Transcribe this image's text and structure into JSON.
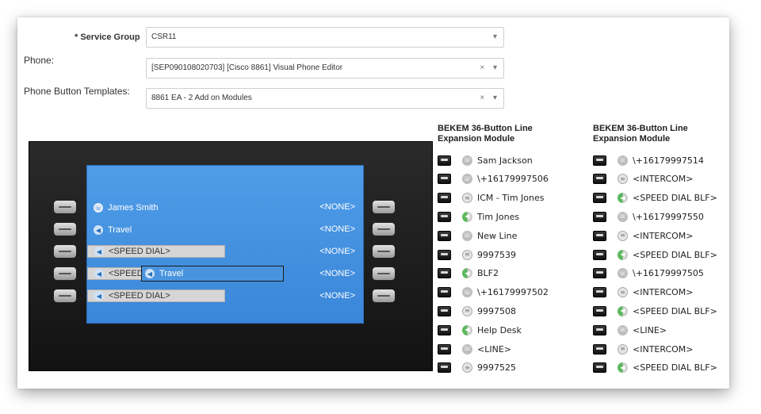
{
  "form": {
    "service_group": {
      "label": "* Service Group",
      "value": "CSR11"
    },
    "phone": {
      "label": "Phone:",
      "value": "[SEP090108020703] [Cisco 8861] Visual Phone Editor"
    },
    "template": {
      "label": "Phone Button Templates:",
      "value": "8861 EA - 2 Add on Modules"
    },
    "clear_glyph": "×",
    "caret_glyph": "▾"
  },
  "phone_screen": {
    "lines": [
      {
        "label": "James Smith",
        "type": "line"
      },
      {
        "label": "Travel",
        "type": "speed"
      },
      {
        "label": "<SPEED DIAL>",
        "type": "speed-bar"
      },
      {
        "label": "<SPEED",
        "type": "speed-bar"
      },
      {
        "label": "<SPEED DIAL>",
        "type": "speed-bar"
      }
    ],
    "right_labels": [
      "<NONE>",
      "<NONE>",
      "<NONE>",
      "<NONE>",
      "<NONE>"
    ],
    "drag_item": "Travel"
  },
  "modules": [
    {
      "title_line1": "BEKEM 36-Button Line",
      "title_line2": "Expansion Module",
      "items": [
        {
          "label": "Sam Jackson",
          "type": "line"
        },
        {
          "label": "\\+16179997506",
          "type": "line"
        },
        {
          "label": "ICM - Tim Jones",
          "type": "intercom"
        },
        {
          "label": "Tim Jones",
          "type": "speed"
        },
        {
          "label": "New Line",
          "type": "line"
        },
        {
          "label": "9997539",
          "type": "intercom"
        },
        {
          "label": "BLF2",
          "type": "speed"
        },
        {
          "label": "\\+16179997502",
          "type": "line"
        },
        {
          "label": "9997508",
          "type": "intercom"
        },
        {
          "label": "Help Desk",
          "type": "speed"
        },
        {
          "label": "<LINE>",
          "type": "line"
        },
        {
          "label": "9997525",
          "type": "intercom"
        }
      ]
    },
    {
      "title_line1": "BEKEM 36-Button Line",
      "title_line2": "Expansion Module",
      "items": [
        {
          "label": "\\+16179997514",
          "type": "line"
        },
        {
          "label": "<INTERCOM>",
          "type": "intercom"
        },
        {
          "label": "<SPEED DIAL BLF>",
          "type": "speed"
        },
        {
          "label": "\\+16179997550",
          "type": "line"
        },
        {
          "label": "<INTERCOM>",
          "type": "intercom"
        },
        {
          "label": "<SPEED DIAL BLF>",
          "type": "speed"
        },
        {
          "label": "\\+16179997505",
          "type": "line"
        },
        {
          "label": "<INTERCOM>",
          "type": "intercom"
        },
        {
          "label": "<SPEED DIAL BLF>",
          "type": "speed"
        },
        {
          "label": "<LINE>",
          "type": "line"
        },
        {
          "label": "<INTERCOM>",
          "type": "intercom"
        },
        {
          "label": "<SPEED DIAL BLF>",
          "type": "speed"
        }
      ]
    }
  ],
  "colors": {
    "screen_blue": "#3a86d9",
    "speed_green": "#5cb85c"
  }
}
